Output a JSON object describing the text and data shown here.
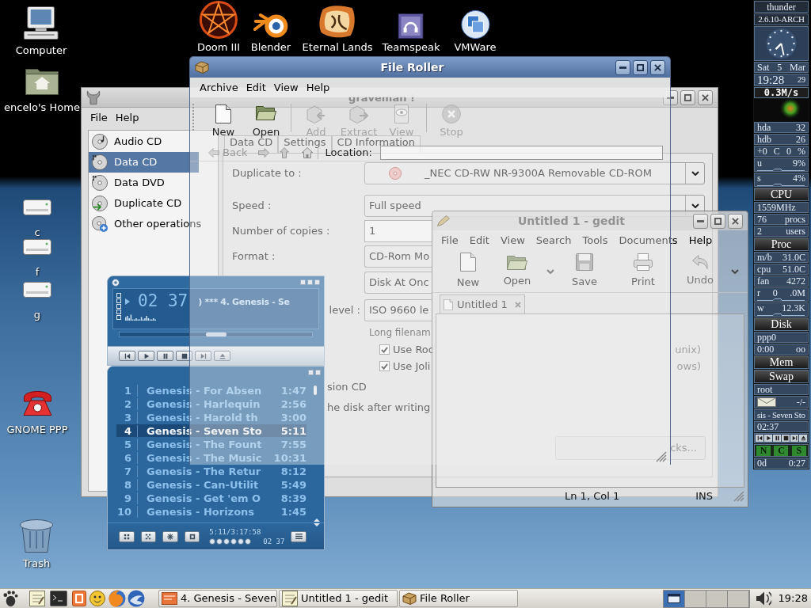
{
  "desktop_icons": [
    {
      "kind": "computer",
      "label": "Computer"
    },
    {
      "kind": "home",
      "label": "encelo's Home"
    },
    {
      "kind": "drive",
      "label": "c"
    },
    {
      "kind": "drive",
      "label": "f"
    },
    {
      "kind": "drive",
      "label": "g"
    },
    {
      "kind": "phone",
      "label": "GNOME PPP"
    },
    {
      "kind": "trash",
      "label": "Trash"
    }
  ],
  "top_icons": [
    {
      "kind": "pentagram",
      "label": "Doom III"
    },
    {
      "kind": "blender",
      "label": "Blender"
    },
    {
      "kind": "scroll",
      "label": "Eternal Lands"
    },
    {
      "kind": "tile",
      "label": "Teamspeak"
    },
    {
      "kind": "sphere",
      "label": "VMWare"
    }
  ],
  "graveman_window": {
    "title": "graveman !",
    "menu": [
      "File",
      "Help"
    ],
    "sidebar": [
      {
        "kind": "audio",
        "label": "Audio CD",
        "selected": false
      },
      {
        "kind": "data",
        "label": "Data CD",
        "selected": true
      },
      {
        "kind": "data",
        "label": "Data DVD",
        "selected": false
      },
      {
        "kind": "duplicate",
        "label": "Duplicate CD",
        "selected": false
      },
      {
        "kind": "other",
        "label": "Other operations",
        "selected": false
      }
    ],
    "tabs": [
      "Data CD",
      "Settings",
      "CD Information"
    ],
    "fields": [
      {
        "kind": "device",
        "label": "Duplicate to :",
        "label_cut": false,
        "value": "_NEC CD-RW NR-9300A Removable CD-ROM"
      },
      {
        "kind": "combo",
        "label": "Speed :",
        "label_cut": false,
        "value": "Full speed"
      },
      {
        "kind": "entry",
        "label": "Number of copies :",
        "label_cut": false,
        "value": "1"
      },
      {
        "kind": "combo",
        "label": "Format :",
        "label_cut": false,
        "value": "CD-Rom Mo"
      },
      {
        "kind": "combo",
        "value": "Disk At Onc"
      },
      {
        "kind": "combo",
        "label": "level :",
        "label_cut": true,
        "value": "ISO 9660 le"
      }
    ],
    "group_label": "Long filenam",
    "checkboxes": [
      {
        "label": "Use Roc",
        "tail": "unix)",
        "checked": true
      },
      {
        "label": "Use Joli",
        "tail": "ows)",
        "checked": true
      }
    ],
    "options": [
      "sion CD",
      "he disk after writing"
    ],
    "button": "cks..."
  },
  "player": {
    "time": "02 37",
    "marquee": ") *** 4. Genesis - Se",
    "seek": {
      "level": 0.5
    },
    "playlist": [
      {
        "number": "1",
        "title": "Genesis - For Absen",
        "length": "1:47",
        "selected": false
      },
      {
        "number": "2",
        "title": "Genesis - Harlequin",
        "length": "2:56",
        "selected": false
      },
      {
        "number": "3",
        "title": "Genesis - Harold th",
        "length": "3:00",
        "selected": false
      },
      {
        "number": "4",
        "title": "Genesis - Seven Sto",
        "length": "5:11",
        "selected": true
      },
      {
        "number": "5",
        "title": "Genesis - The Fount",
        "length": "7:55",
        "selected": false
      },
      {
        "number": "6",
        "title": "Genesis - The Music",
        "length": "10:31",
        "selected": false
      },
      {
        "number": "7",
        "title": "Genesis - The Retur",
        "length": "8:12",
        "selected": false
      },
      {
        "number": "8",
        "title": "Genesis - Can-Utilit",
        "length": "5:49",
        "selected": false
      },
      {
        "number": "9",
        "title": "Genesis - Get 'em O",
        "length": "8:39",
        "selected": false
      },
      {
        "number": "10",
        "title": "Genesis - Horizons",
        "length": "1:45",
        "selected": false
      }
    ],
    "total_time": "5:11/3:17:58",
    "mini_time": "02 37"
  },
  "gedit_window": {
    "title": "Untitled 1 - gedit",
    "menu": [
      "File",
      "Edit",
      "View",
      "Search",
      "Tools",
      "Documents",
      "Help"
    ],
    "toolbar": [
      {
        "kind": "new",
        "label": "New",
        "disabled": false
      },
      {
        "kind": "open",
        "label": "Open",
        "disabled": false
      },
      {
        "kind": "menu"
      },
      {
        "kind": "save",
        "label": "Save",
        "disabled": false
      },
      {
        "kind": "print",
        "label": "Print",
        "disabled": false
      },
      {
        "kind": "undo",
        "label": "Undo",
        "disabled": true
      },
      {
        "kind": "more"
      }
    ],
    "tab": "Untitled 1",
    "status": [
      "Ln 1, Col 1",
      "INS"
    ]
  },
  "file_roller_window": {
    "title": "File Roller",
    "menu": [
      "Archive",
      "Edit",
      "View",
      "Help"
    ],
    "toolbar": [
      {
        "kind": "new",
        "label": "New",
        "disabled": false
      },
      {
        "kind": "open",
        "label": "Open",
        "disabled": false
      },
      {
        "kind": "separator"
      },
      {
        "kind": "add",
        "label": "Add",
        "disabled": true
      },
      {
        "kind": "extract",
        "label": "Extract",
        "disabled": true
      },
      {
        "kind": "view",
        "label": "View",
        "disabled": true
      },
      {
        "kind": "separator"
      },
      {
        "kind": "stop",
        "label": "Stop",
        "disabled": true
      }
    ],
    "back": {
      "label": "Back",
      "disabled": true
    },
    "location_label": "Location:"
  },
  "gkrellm": {
    "panels": [
      {
        "kind": "label",
        "texts": [
          "thunder"
        ]
      },
      {
        "kind": "label",
        "texts": [
          "2.6.10-ARCH"
        ]
      },
      {
        "kind": "clock"
      },
      {
        "kind": "row",
        "texts": [
          "Sat",
          "5",
          "Mar"
        ]
      },
      {
        "kind": "time",
        "texts": [
          "19:28",
          "29"
        ]
      },
      {
        "kind": "speed",
        "texts": [
          "0.3M/s"
        ]
      },
      {
        "kind": "chart"
      },
      {
        "kind": "row",
        "texts": [
          "hda",
          "32"
        ]
      },
      {
        "kind": "row",
        "texts": [
          "hdb",
          "26"
        ]
      },
      {
        "kind": "row",
        "texts": [
          "+0",
          "C",
          "0",
          "%"
        ]
      },
      {
        "kind": "meter",
        "texts": [
          "u",
          "9%"
        ]
      },
      {
        "kind": "meter",
        "texts": [
          "s",
          "4%"
        ]
      },
      {
        "kind": "header",
        "texts": [
          "CPU"
        ]
      },
      {
        "kind": "row",
        "texts": [
          "1559MHz"
        ]
      },
      {
        "kind": "row",
        "texts": [
          "76",
          "procs"
        ]
      },
      {
        "kind": "row",
        "texts": [
          "2",
          "users"
        ]
      },
      {
        "kind": "header",
        "texts": [
          "Proc"
        ]
      },
      {
        "kind": "row",
        "texts": [
          "m/b",
          "31.0C"
        ]
      },
      {
        "kind": "row",
        "texts": [
          "cpu",
          "51.0C"
        ]
      },
      {
        "kind": "row",
        "texts": [
          "fan",
          "4272"
        ]
      },
      {
        "kind": "meter",
        "texts": [
          "r",
          "0",
          ".0M"
        ]
      },
      {
        "kind": "meter",
        "texts": [
          "w",
          "12.3K"
        ]
      },
      {
        "kind": "header",
        "texts": [
          "Disk"
        ]
      },
      {
        "kind": "row",
        "texts": [
          "ppp0"
        ]
      },
      {
        "kind": "row",
        "texts": [
          "0:00",
          "oo"
        ]
      },
      {
        "kind": "header",
        "texts": [
          "Mem"
        ]
      },
      {
        "kind": "header",
        "texts": [
          "Swap"
        ]
      },
      {
        "kind": "row",
        "texts": [
          "root"
        ]
      },
      {
        "kind": "mail",
        "texts": [
          "-/-"
        ]
      },
      {
        "kind": "row",
        "texts": [
          "sis - Seven Sto"
        ]
      },
      {
        "kind": "row",
        "texts": [
          "02:37"
        ]
      },
      {
        "kind": "controls"
      },
      {
        "kind": "leds",
        "texts": [
          "N",
          "C",
          "S"
        ]
      },
      {
        "kind": "row",
        "texts": [
          "0d",
          "0:27"
        ]
      }
    ]
  },
  "taskbar": {
    "launchers": [
      {
        "kind": "foot"
      },
      {
        "kind": "notes"
      },
      {
        "kind": "terminal"
      },
      {
        "kind": "tile"
      },
      {
        "kind": "smiley"
      },
      {
        "kind": "fox"
      },
      {
        "kind": "bird"
      }
    ],
    "tasks": [
      {
        "kind": "player",
        "label": "4. Genesis - Seven"
      },
      {
        "kind": "editor",
        "label": "Untitled 1 - gedit"
      },
      {
        "kind": "archiver",
        "label": "File Roller"
      }
    ],
    "workspaces": [
      {
        "selected": true
      },
      {
        "selected": false
      },
      {
        "selected": false
      },
      {
        "selected": false
      }
    ],
    "clock": "19:28"
  }
}
